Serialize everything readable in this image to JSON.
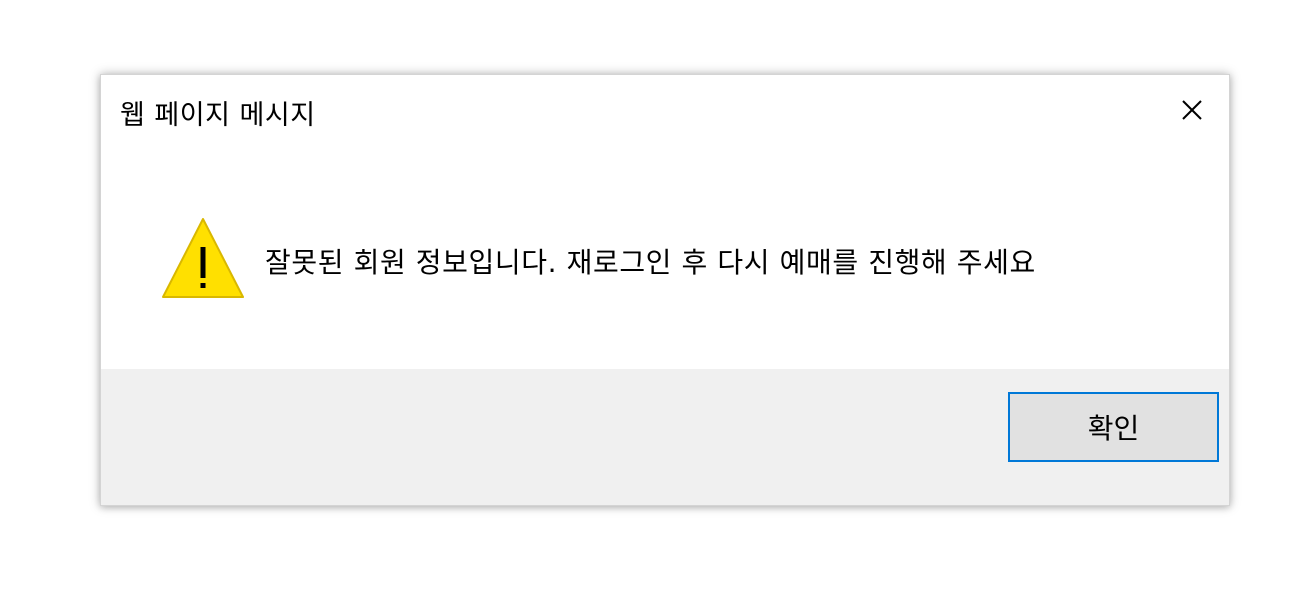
{
  "dialog": {
    "title": "웹 페이지 메시지",
    "message": "잘못된 회원 정보입니다. 재로그인 후 다시 예매를 진행해 주세요",
    "ok_label": "확인",
    "icons": {
      "close": "close-icon",
      "warning": "warning-icon"
    },
    "colors": {
      "warning_fill": "#FFE000",
      "warning_stroke": "#D9B800",
      "button_border": "#0078D7",
      "footer_bg": "#F0F0F0"
    }
  }
}
